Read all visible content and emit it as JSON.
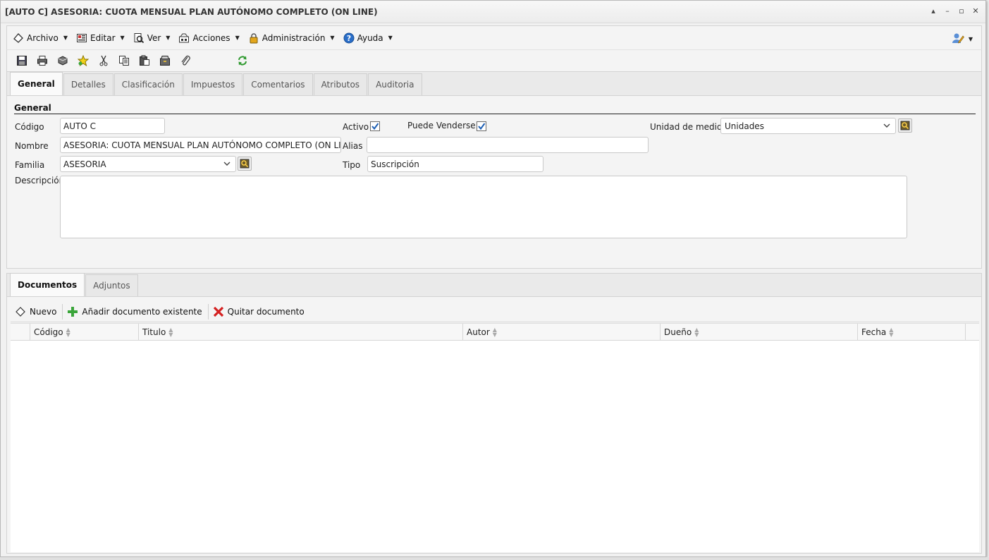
{
  "window": {
    "title": "[AUTO C] ASESORIA: CUOTA MENSUAL PLAN AUTÓNOMO COMPLETO (ON LINE)",
    "controls": [
      "▴",
      "–",
      "▫",
      "✕"
    ]
  },
  "menu": [
    {
      "label": "Archivo",
      "icon": "archivo-icon"
    },
    {
      "label": "Editar",
      "icon": "editar-icon"
    },
    {
      "label": "Ver",
      "icon": "ver-icon"
    },
    {
      "label": "Acciones",
      "icon": "acciones-icon"
    },
    {
      "label": "Administración",
      "icon": "lock-icon"
    },
    {
      "label": "Ayuda",
      "icon": "help-icon"
    }
  ],
  "toolbar_icons": [
    "save-icon",
    "print-icon",
    "delete-icon",
    "favorite-icon",
    "cut-icon",
    "copy-icon",
    "paste-icon",
    "archive-icon",
    "attach-icon",
    "refresh-icon"
  ],
  "tabs": [
    {
      "label": "General",
      "active": true
    },
    {
      "label": "Detalles"
    },
    {
      "label": "Clasificación"
    },
    {
      "label": "Impuestos"
    },
    {
      "label": "Comentarios"
    },
    {
      "label": "Atributos"
    },
    {
      "label": "Auditoria"
    }
  ],
  "form": {
    "section_title": "General",
    "codigo_label": "Código",
    "codigo_value": "AUTO C",
    "nombre_label": "Nombre",
    "nombre_value": "ASESORIA: CUOTA MENSUAL PLAN AUTÓNOMO COMPLETO (ON LINE)",
    "familia_label": "Familia",
    "familia_value": "ASESORIA",
    "descripcion_label": "Descripción",
    "descripcion_value": "",
    "activo_label": "Activo",
    "activo_checked": true,
    "puede_venderse_label": "Puede Venderse",
    "puede_venderse_checked": true,
    "alias_label": "Alias",
    "alias_value": "",
    "tipo_label": "Tipo",
    "tipo_value": "Suscripción",
    "unidad_label": "Unidad de medida",
    "unidad_value": "Unidades"
  },
  "doc_tabs": [
    {
      "label": "Documentos",
      "active": true
    },
    {
      "label": "Adjuntos"
    }
  ],
  "doc_toolbar": {
    "nuevo": "Nuevo",
    "anadir": "Añadir documento existente",
    "quitar": "Quitar documento"
  },
  "grid_columns": [
    "Código",
    "Titulo",
    "Autor",
    "Dueño",
    "Fecha"
  ],
  "colors": {
    "accent_blue": "#1e5fb3",
    "delete_red": "#d42020",
    "add_green": "#3aa53a"
  }
}
